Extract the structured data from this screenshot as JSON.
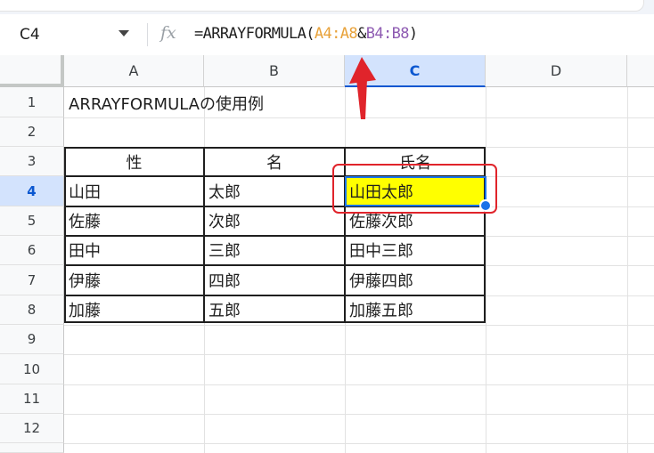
{
  "name_box": "C4",
  "fx_label": "fx",
  "formula": {
    "prefix": "=ARRAYFORMULA(",
    "ref1": "A4:A8",
    "amp": "&",
    "ref2": "B4:B8",
    "suffix": ")"
  },
  "columns": [
    "A",
    "B",
    "C",
    "D"
  ],
  "rows": [
    "1",
    "2",
    "3",
    "4",
    "5",
    "6",
    "7",
    "8",
    "9",
    "10",
    "11",
    "12"
  ],
  "sheet": {
    "a1": "ARRAYFORMULAの使用例",
    "headers": [
      "性",
      "名",
      "氏名"
    ],
    "data": [
      [
        "山田",
        "太郎",
        "山田太郎"
      ],
      [
        "佐藤",
        "次郎",
        "佐藤次郎"
      ],
      [
        "田中",
        "三郎",
        "田中三郎"
      ],
      [
        "伊藤",
        "四郎",
        "伊藤四郎"
      ],
      [
        "加藤",
        "五郎",
        "加藤五郎"
      ]
    ]
  },
  "colors": {
    "highlight": "#ffff00",
    "selection": "#1a73e8",
    "annotation": "#e0242b",
    "ref1": "#e8a23a",
    "ref2": "#8e5bb2"
  }
}
